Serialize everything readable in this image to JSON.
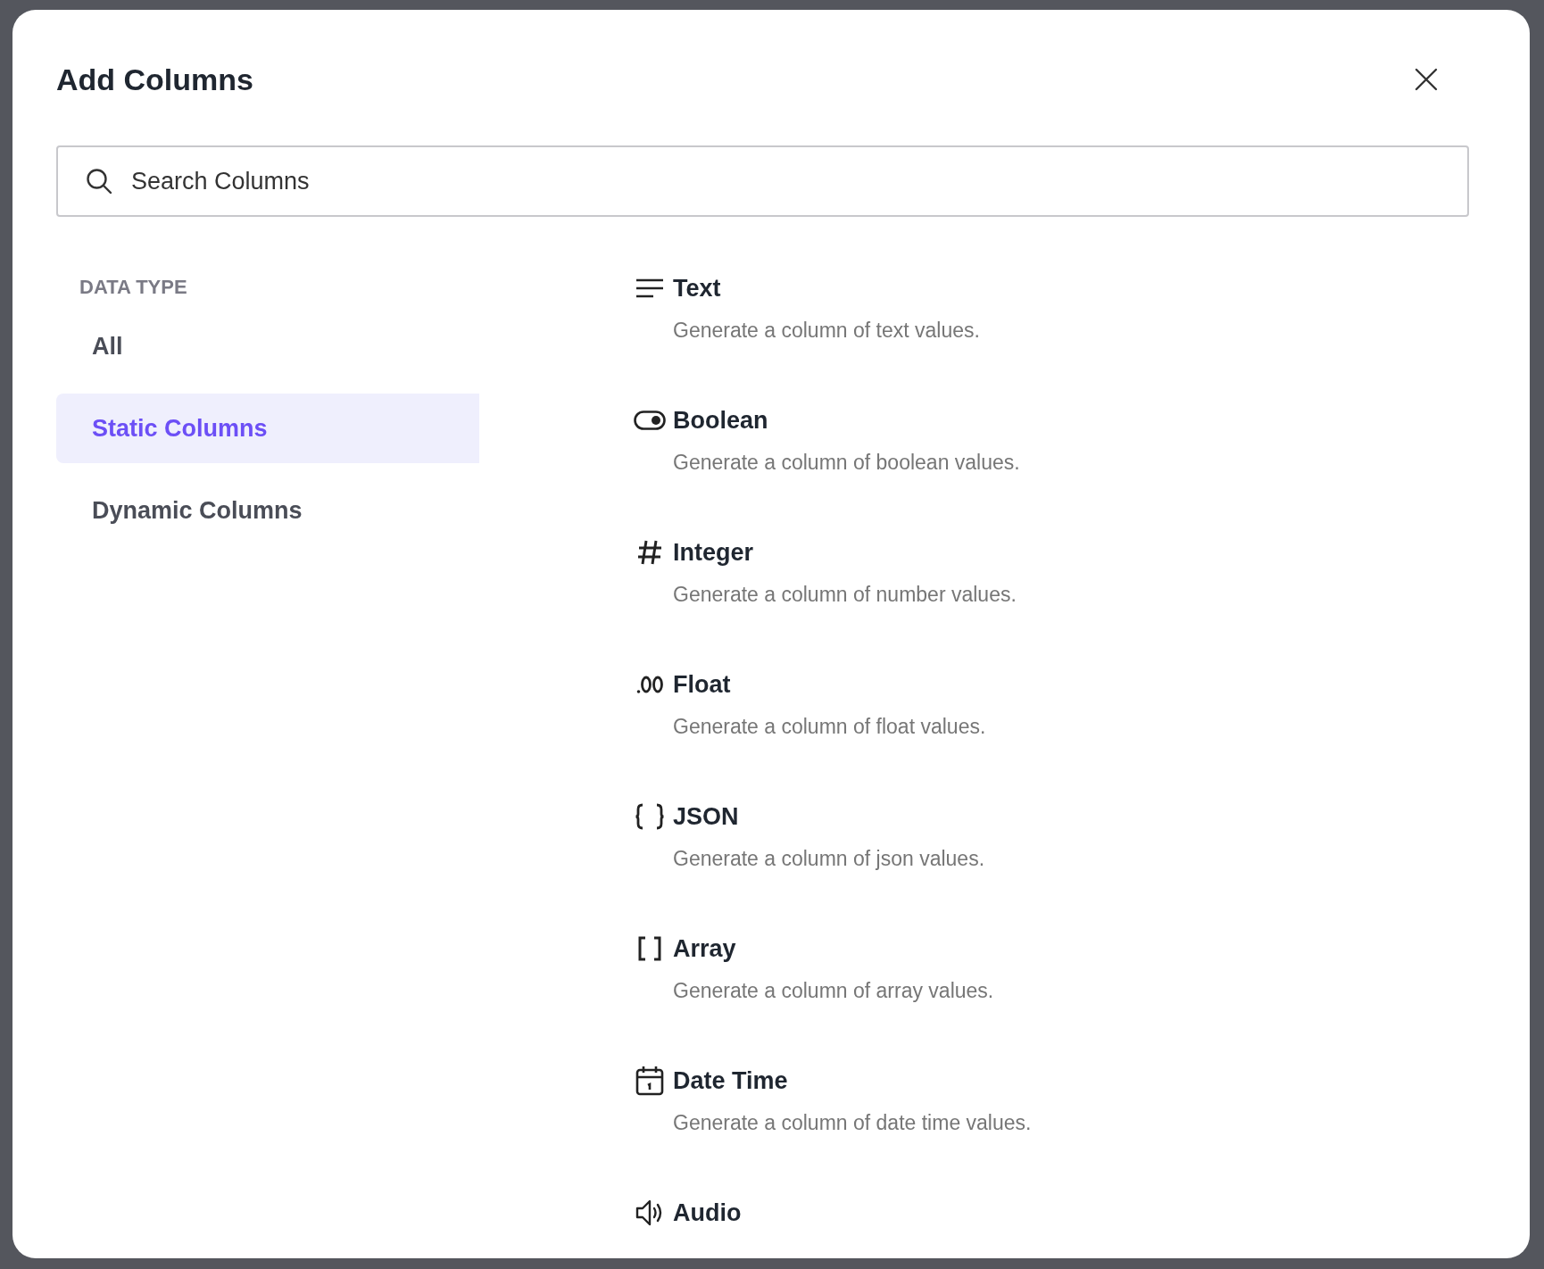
{
  "dialog": {
    "title": "Add Columns"
  },
  "search": {
    "placeholder": "Search Columns"
  },
  "sidebar": {
    "heading": "DATA TYPE",
    "items": [
      {
        "label": "All",
        "selected": false
      },
      {
        "label": "Static Columns",
        "selected": true
      },
      {
        "label": "Dynamic Columns",
        "selected": false
      }
    ]
  },
  "column_types": [
    {
      "kind": "text",
      "name": "Text",
      "description": "Generate a column of text values."
    },
    {
      "kind": "boolean",
      "name": "Boolean",
      "description": "Generate a column of boolean values."
    },
    {
      "kind": "integer",
      "name": "Integer",
      "description": "Generate a column of number values."
    },
    {
      "kind": "float",
      "name": "Float",
      "description": "Generate a column of float values."
    },
    {
      "kind": "json",
      "name": "JSON",
      "description": "Generate a column of json values."
    },
    {
      "kind": "array",
      "name": "Array",
      "description": "Generate a column of array values."
    },
    {
      "kind": "datetime",
      "name": "Date Time",
      "description": "Generate a column of date time values."
    },
    {
      "kind": "audio",
      "name": "Audio"
    }
  ]
}
